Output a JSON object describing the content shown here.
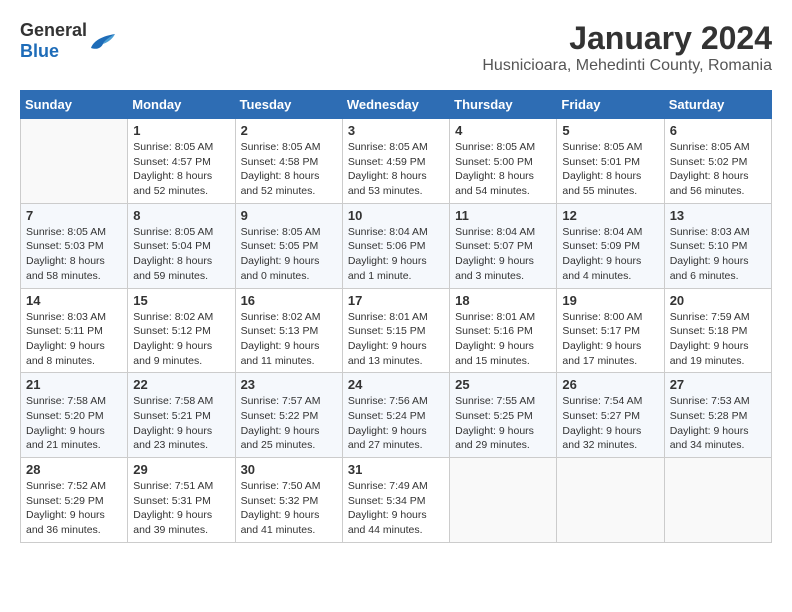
{
  "header": {
    "logo_general": "General",
    "logo_blue": "Blue",
    "month": "January 2024",
    "location": "Husnicioara, Mehedinti County, Romania"
  },
  "weekdays": [
    "Sunday",
    "Monday",
    "Tuesday",
    "Wednesday",
    "Thursday",
    "Friday",
    "Saturday"
  ],
  "weeks": [
    [
      {
        "day": "",
        "info": ""
      },
      {
        "day": "1",
        "info": "Sunrise: 8:05 AM\nSunset: 4:57 PM\nDaylight: 8 hours\nand 52 minutes."
      },
      {
        "day": "2",
        "info": "Sunrise: 8:05 AM\nSunset: 4:58 PM\nDaylight: 8 hours\nand 52 minutes."
      },
      {
        "day": "3",
        "info": "Sunrise: 8:05 AM\nSunset: 4:59 PM\nDaylight: 8 hours\nand 53 minutes."
      },
      {
        "day": "4",
        "info": "Sunrise: 8:05 AM\nSunset: 5:00 PM\nDaylight: 8 hours\nand 54 minutes."
      },
      {
        "day": "5",
        "info": "Sunrise: 8:05 AM\nSunset: 5:01 PM\nDaylight: 8 hours\nand 55 minutes."
      },
      {
        "day": "6",
        "info": "Sunrise: 8:05 AM\nSunset: 5:02 PM\nDaylight: 8 hours\nand 56 minutes."
      }
    ],
    [
      {
        "day": "7",
        "info": "Sunrise: 8:05 AM\nSunset: 5:03 PM\nDaylight: 8 hours\nand 58 minutes."
      },
      {
        "day": "8",
        "info": "Sunrise: 8:05 AM\nSunset: 5:04 PM\nDaylight: 8 hours\nand 59 minutes."
      },
      {
        "day": "9",
        "info": "Sunrise: 8:05 AM\nSunset: 5:05 PM\nDaylight: 9 hours\nand 0 minutes."
      },
      {
        "day": "10",
        "info": "Sunrise: 8:04 AM\nSunset: 5:06 PM\nDaylight: 9 hours\nand 1 minute."
      },
      {
        "day": "11",
        "info": "Sunrise: 8:04 AM\nSunset: 5:07 PM\nDaylight: 9 hours\nand 3 minutes."
      },
      {
        "day": "12",
        "info": "Sunrise: 8:04 AM\nSunset: 5:09 PM\nDaylight: 9 hours\nand 4 minutes."
      },
      {
        "day": "13",
        "info": "Sunrise: 8:03 AM\nSunset: 5:10 PM\nDaylight: 9 hours\nand 6 minutes."
      }
    ],
    [
      {
        "day": "14",
        "info": "Sunrise: 8:03 AM\nSunset: 5:11 PM\nDaylight: 9 hours\nand 8 minutes."
      },
      {
        "day": "15",
        "info": "Sunrise: 8:02 AM\nSunset: 5:12 PM\nDaylight: 9 hours\nand 9 minutes."
      },
      {
        "day": "16",
        "info": "Sunrise: 8:02 AM\nSunset: 5:13 PM\nDaylight: 9 hours\nand 11 minutes."
      },
      {
        "day": "17",
        "info": "Sunrise: 8:01 AM\nSunset: 5:15 PM\nDaylight: 9 hours\nand 13 minutes."
      },
      {
        "day": "18",
        "info": "Sunrise: 8:01 AM\nSunset: 5:16 PM\nDaylight: 9 hours\nand 15 minutes."
      },
      {
        "day": "19",
        "info": "Sunrise: 8:00 AM\nSunset: 5:17 PM\nDaylight: 9 hours\nand 17 minutes."
      },
      {
        "day": "20",
        "info": "Sunrise: 7:59 AM\nSunset: 5:18 PM\nDaylight: 9 hours\nand 19 minutes."
      }
    ],
    [
      {
        "day": "21",
        "info": "Sunrise: 7:58 AM\nSunset: 5:20 PM\nDaylight: 9 hours\nand 21 minutes."
      },
      {
        "day": "22",
        "info": "Sunrise: 7:58 AM\nSunset: 5:21 PM\nDaylight: 9 hours\nand 23 minutes."
      },
      {
        "day": "23",
        "info": "Sunrise: 7:57 AM\nSunset: 5:22 PM\nDaylight: 9 hours\nand 25 minutes."
      },
      {
        "day": "24",
        "info": "Sunrise: 7:56 AM\nSunset: 5:24 PM\nDaylight: 9 hours\nand 27 minutes."
      },
      {
        "day": "25",
        "info": "Sunrise: 7:55 AM\nSunset: 5:25 PM\nDaylight: 9 hours\nand 29 minutes."
      },
      {
        "day": "26",
        "info": "Sunrise: 7:54 AM\nSunset: 5:27 PM\nDaylight: 9 hours\nand 32 minutes."
      },
      {
        "day": "27",
        "info": "Sunrise: 7:53 AM\nSunset: 5:28 PM\nDaylight: 9 hours\nand 34 minutes."
      }
    ],
    [
      {
        "day": "28",
        "info": "Sunrise: 7:52 AM\nSunset: 5:29 PM\nDaylight: 9 hours\nand 36 minutes."
      },
      {
        "day": "29",
        "info": "Sunrise: 7:51 AM\nSunset: 5:31 PM\nDaylight: 9 hours\nand 39 minutes."
      },
      {
        "day": "30",
        "info": "Sunrise: 7:50 AM\nSunset: 5:32 PM\nDaylight: 9 hours\nand 41 minutes."
      },
      {
        "day": "31",
        "info": "Sunrise: 7:49 AM\nSunset: 5:34 PM\nDaylight: 9 hours\nand 44 minutes."
      },
      {
        "day": "",
        "info": ""
      },
      {
        "day": "",
        "info": ""
      },
      {
        "day": "",
        "info": ""
      }
    ]
  ]
}
